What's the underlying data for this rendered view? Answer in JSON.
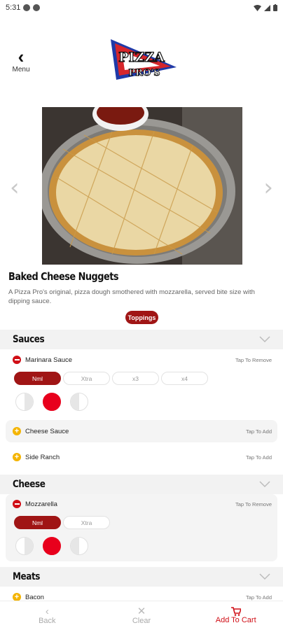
{
  "status_bar": {
    "time": "5:31"
  },
  "header": {
    "back_label": "Menu",
    "logo_text_top": "PIZZA",
    "logo_text_bottom": "PRO'S"
  },
  "product": {
    "title": "Baked Cheese Nuggets",
    "description": "A Pizza Pro's original, pizza dough smothered with mozzarella, served bite size with dipping sauce.",
    "toppings_button": "Toppings"
  },
  "sections": {
    "sauces": {
      "title": "Sauces",
      "marinara": {
        "name": "Marinara Sauce",
        "hint": "Tap To Remove",
        "amounts": [
          "Nml",
          "Xtra",
          "x3",
          "x4"
        ],
        "selected_amount": "Nml"
      },
      "cheese_sauce": {
        "name": "Cheese Sauce",
        "hint": "Tap To Add"
      },
      "side_ranch": {
        "name": "Side Ranch",
        "hint": "Tap To Add"
      }
    },
    "cheese": {
      "title": "Cheese",
      "mozzarella": {
        "name": "Mozzarella",
        "hint": "Tap To Remove",
        "amounts": [
          "Nml",
          "Xtra"
        ],
        "selected_amount": "Nml"
      }
    },
    "meats": {
      "title": "Meats",
      "bacon": {
        "name": "Bacon",
        "hint": "Tap To Add"
      }
    }
  },
  "bottom_bar": {
    "back": "Back",
    "clear": "Clear",
    "add_to_cart": "Add To Cart"
  },
  "colors": {
    "accent": "#a01515",
    "remove": "#d00e16",
    "add": "#f4b400",
    "portion_selected": "#e8001c"
  }
}
